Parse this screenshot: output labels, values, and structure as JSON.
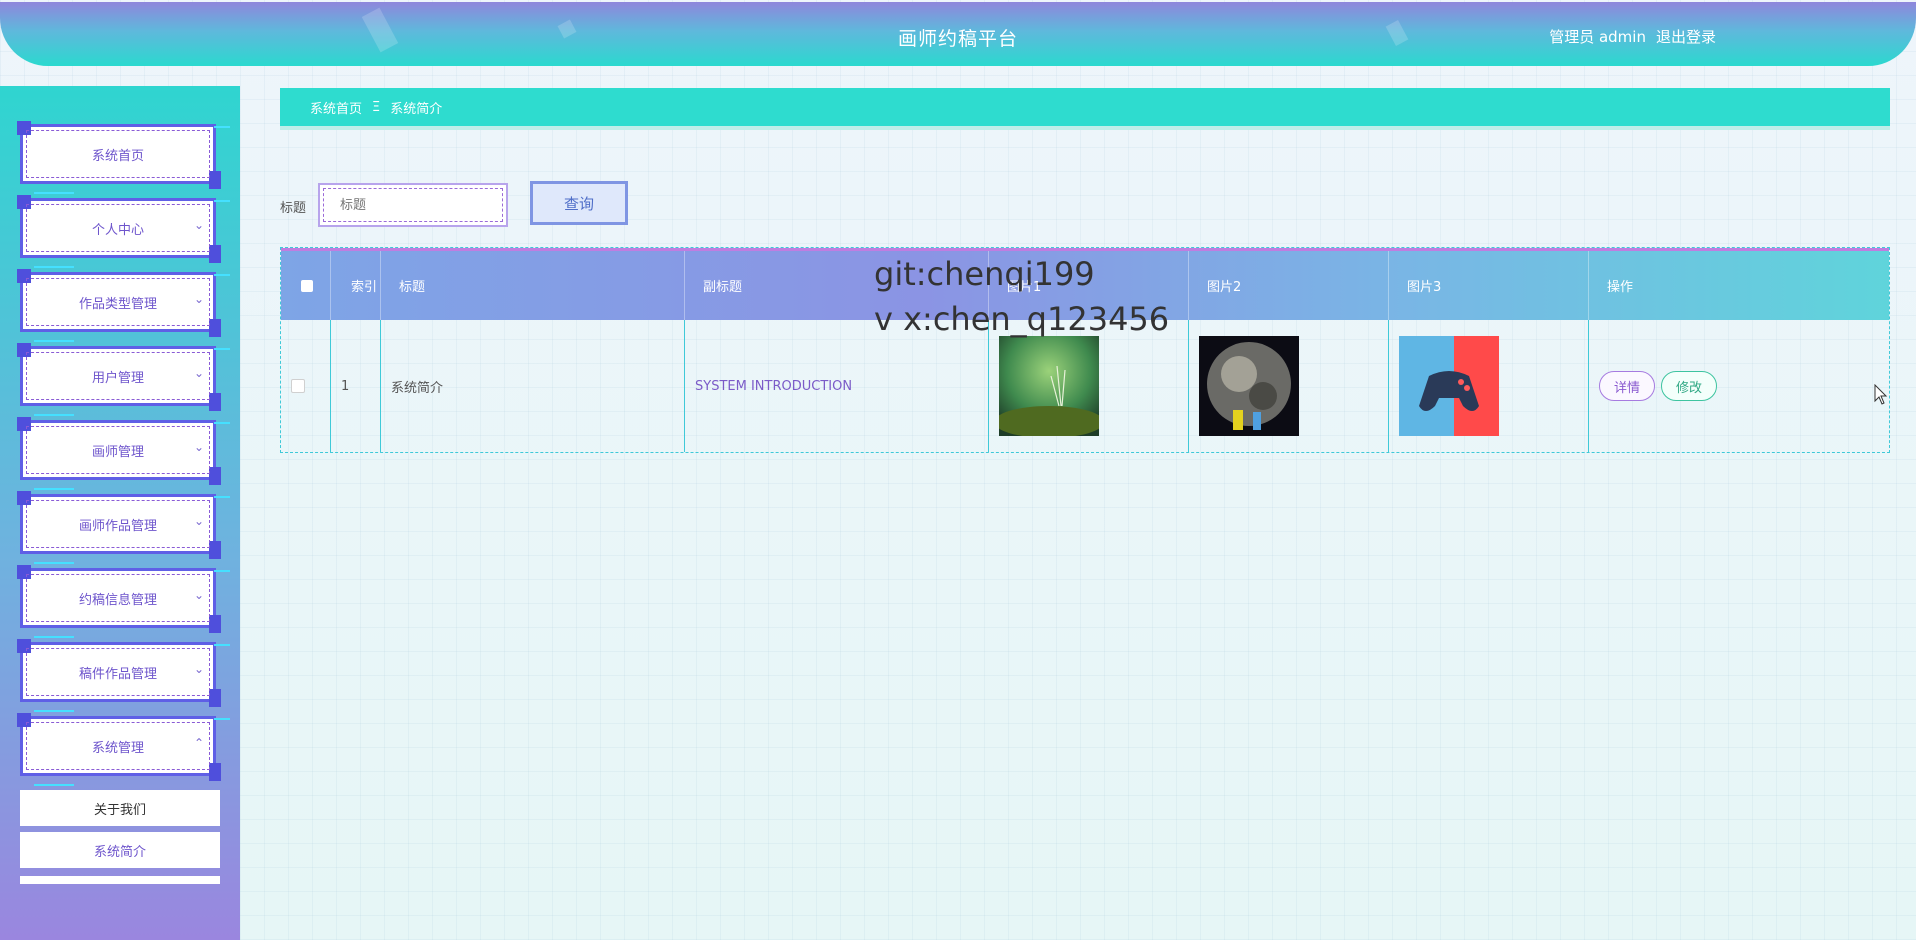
{
  "header": {
    "title": "画师约稿平台",
    "user_label": "管理员 admin",
    "logout_label": "退出登录"
  },
  "sidebar": {
    "items": [
      {
        "label": "系统首页",
        "has_arrow": false
      },
      {
        "label": "个人中心",
        "arrow": "⌄"
      },
      {
        "label": "作品类型管理",
        "arrow": "⌄"
      },
      {
        "label": "用户管理",
        "arrow": "⌄"
      },
      {
        "label": "画师管理",
        "arrow": "⌄"
      },
      {
        "label": "画师作品管理",
        "arrow": "⌄"
      },
      {
        "label": "约稿信息管理",
        "arrow": "⌄"
      },
      {
        "label": "稿件作品管理",
        "arrow": "⌄"
      },
      {
        "label": "系统管理",
        "arrow": "⌃"
      }
    ],
    "submenu": [
      {
        "label": "关于我们"
      },
      {
        "label": "系统简介"
      }
    ]
  },
  "breadcrumb": {
    "home": "系统首页",
    "separator": "Ξ",
    "current": "系统简介"
  },
  "search": {
    "label": "标题",
    "placeholder": "标题",
    "button_label": "查询"
  },
  "table": {
    "headers": [
      "索引",
      "标题",
      "副标题",
      "图片1",
      "图片2",
      "图片3",
      "操作"
    ],
    "rows": [
      {
        "index": "1",
        "title": "系统简介",
        "subtitle": "SYSTEM INTRODUCTION",
        "image1": "green-nature-photo",
        "image2": "earth-planet-photo",
        "image3": "game-controller-photo",
        "detail_label": "详情",
        "edit_label": "修改"
      }
    ]
  },
  "watermark": {
    "line1": "git:chenqi199",
    "line2": "v x:chen_q123456"
  },
  "colors": {
    "accent_cyan": "#2edccf",
    "accent_purple": "#8a5ad0",
    "menu_border": "#5f5fe6"
  }
}
